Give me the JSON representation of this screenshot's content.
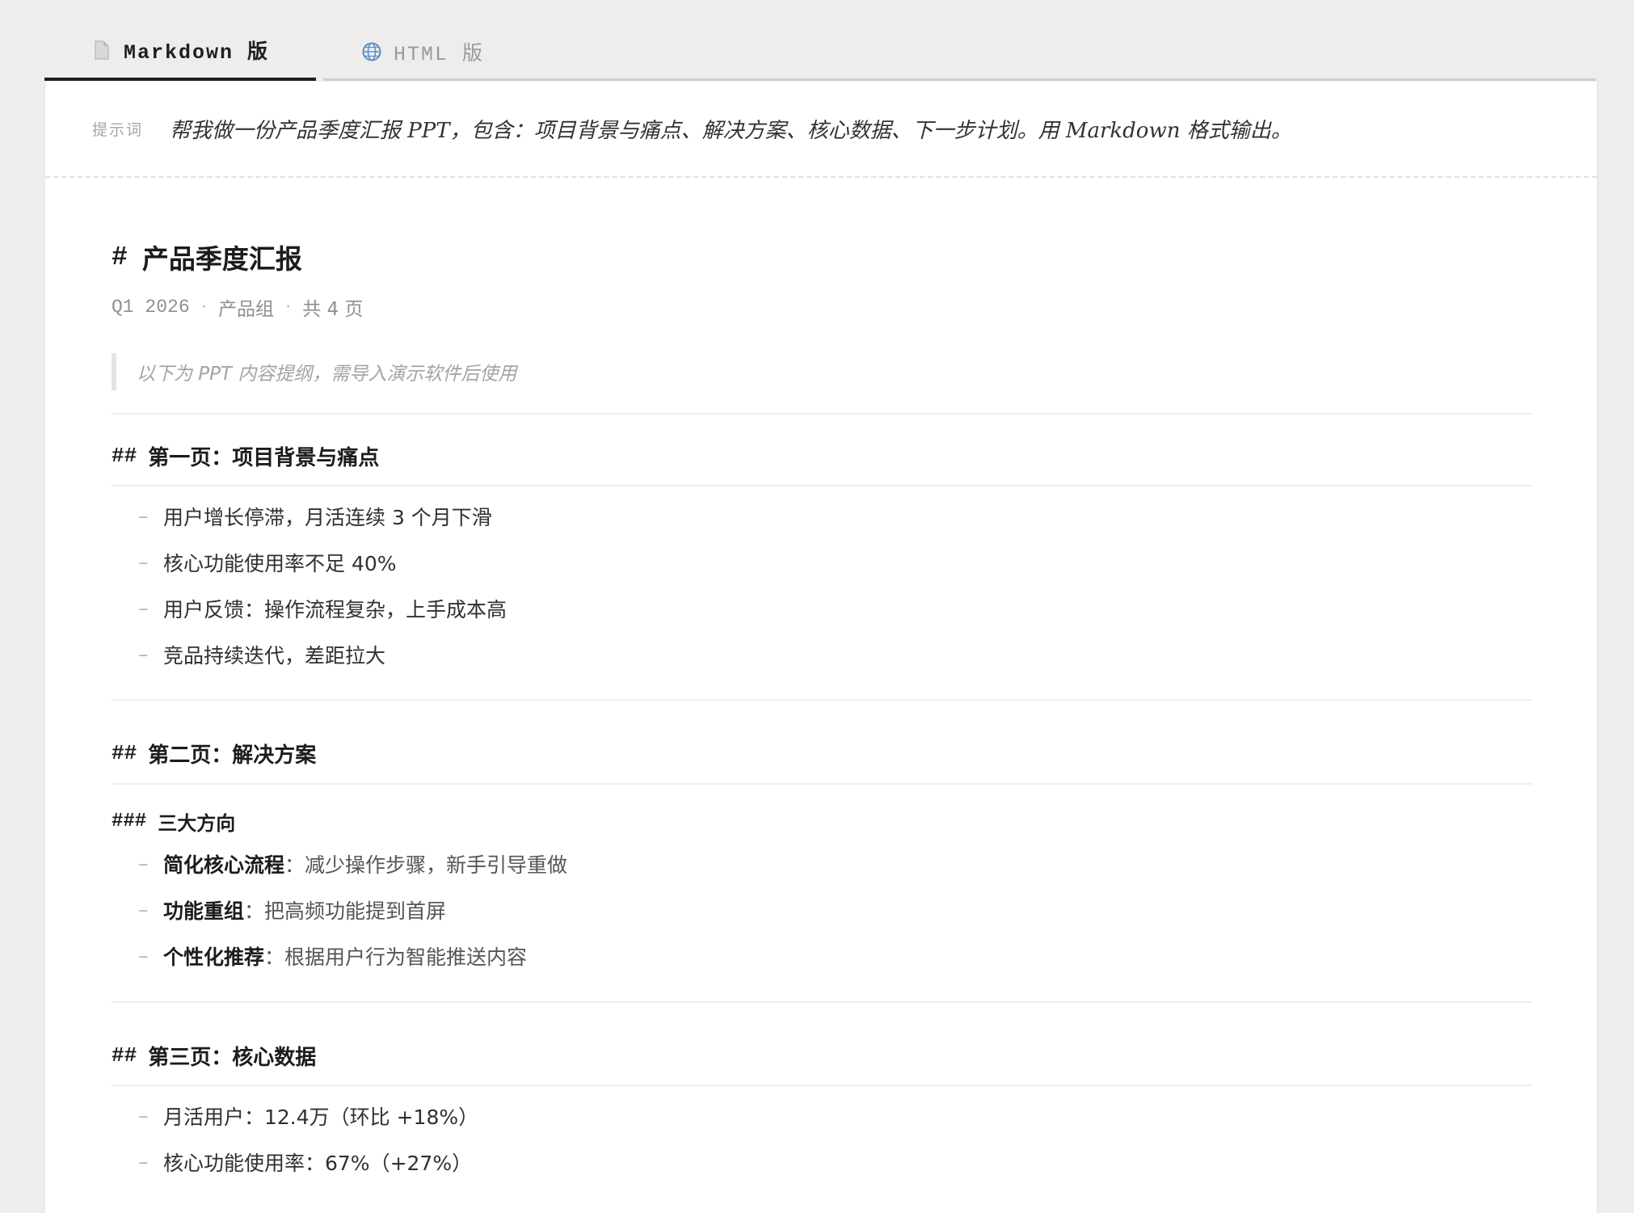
{
  "tabs": [
    {
      "icon": "document-icon",
      "label": "Markdown 版",
      "active": true
    },
    {
      "icon": "globe-icon",
      "label": "HTML 版",
      "active": false
    }
  ],
  "prompt": {
    "label": "提示词",
    "text": "帮我做一份产品季度汇报 PPT，包含：项目背景与痛点、解决方案、核心数据、下一步计划。用 Markdown 格式输出。"
  },
  "doc": {
    "h1_marker": "#",
    "title": "产品季度汇报",
    "meta": [
      "Q1 2026",
      "产品组",
      "共 4 页"
    ],
    "meta_sep": "·",
    "quote": "以下为 PPT 内容提纲，需导入演示软件后使用",
    "h2_marker": "##",
    "h3_marker": "###",
    "dash": "–",
    "sections": [
      {
        "heading": "第一页：项目背景与痛点",
        "items": [
          "用户增长停滞，月活连续 3 个月下滑",
          "核心功能使用率不足 40%",
          "用户反馈：操作流程复杂，上手成本高",
          "竞品持续迭代，差距拉大"
        ]
      },
      {
        "heading": "第二页：解决方案",
        "subheading": "三大方向",
        "items": [
          {
            "bold": "简化核心流程",
            "rest": "：减少操作步骤，新手引导重做"
          },
          {
            "bold": "功能重组",
            "rest": "：把高频功能提到首屏"
          },
          {
            "bold": "个性化推荐",
            "rest": "：根据用户行为智能推送内容"
          }
        ]
      },
      {
        "heading": "第三页：核心数据",
        "items": [
          "月活用户：12.4万（环比 +18%）",
          "核心功能使用率：67%（+27%）"
        ]
      }
    ]
  },
  "colors": {
    "accent": "#1f1f1f",
    "background": "#eeedeb",
    "panel": "#ffffff"
  }
}
